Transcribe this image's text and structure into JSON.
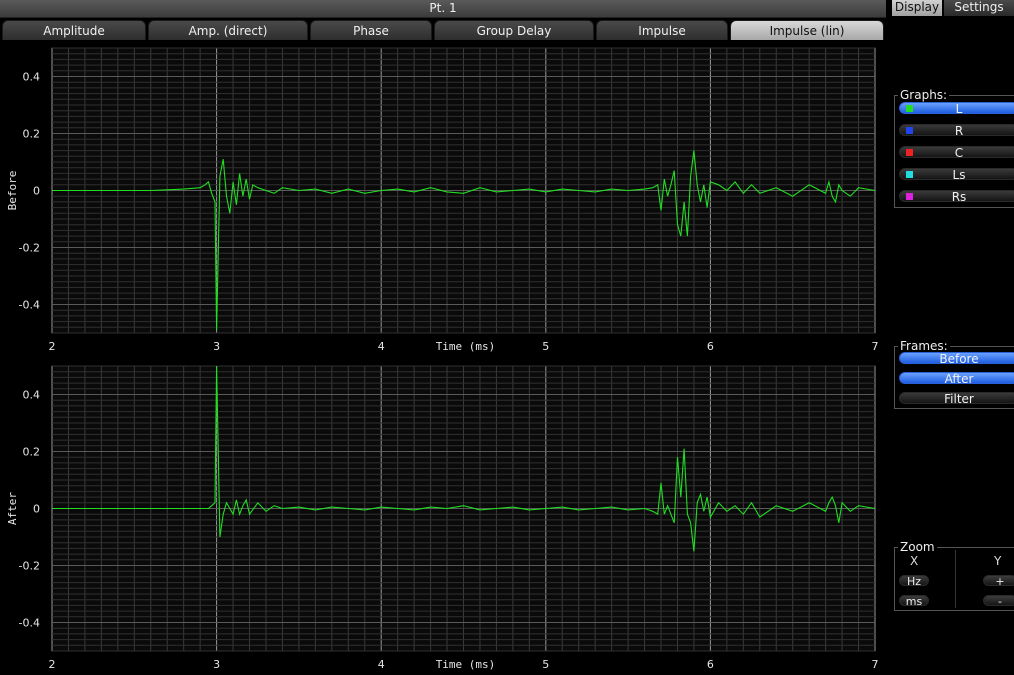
{
  "window": {
    "title": "Pt. 1"
  },
  "tabs": [
    {
      "label": "Amplitude"
    },
    {
      "label": "Amp. (direct)"
    },
    {
      "label": "Phase"
    },
    {
      "label": "Group Delay"
    },
    {
      "label": "Impulse"
    },
    {
      "label": "Impulse (lin)",
      "active": true
    }
  ],
  "side_tabs": {
    "display": "Display",
    "settings": "Settings"
  },
  "graphs": {
    "title": "Graphs:",
    "items": [
      {
        "label": "L",
        "color": "#22dd22",
        "on": true
      },
      {
        "label": "R",
        "color": "#2244ee",
        "on": false
      },
      {
        "label": "C",
        "color": "#ee2222",
        "on": false
      },
      {
        "label": "Ls",
        "color": "#22dddd",
        "on": false
      },
      {
        "label": "Rs",
        "color": "#dd22dd",
        "on": false
      }
    ]
  },
  "frames": {
    "title": "Frames:",
    "items": [
      {
        "label": "Before",
        "on": true
      },
      {
        "label": "After",
        "on": true
      },
      {
        "label": "Filter",
        "on": false
      }
    ]
  },
  "zoom": {
    "title": "Zoom",
    "x_label": "X",
    "y_label": "Y",
    "hz": "Hz",
    "ms": "ms",
    "plus": "+",
    "minus": "-"
  },
  "chart_data": [
    {
      "type": "line",
      "ylabel": "Before",
      "xlabel": "Time (ms)",
      "xlim": [
        2,
        7
      ],
      "ylim": [
        -0.5,
        0.5
      ],
      "x_ticks": [
        2,
        3,
        4,
        5,
        6,
        7
      ],
      "y_ticks": [
        0.4,
        0.2,
        0,
        -0.2,
        -0.4
      ],
      "y_tick_labels": [
        "0.4",
        "0.2",
        "0",
        "-0.2",
        "-0.4"
      ],
      "grid": true,
      "series": [
        {
          "color": "#22dd22",
          "x": [
            2.0,
            2.6,
            2.8,
            2.9,
            2.93,
            2.95,
            2.97,
            2.99,
            3.0,
            3.02,
            3.04,
            3.06,
            3.08,
            3.1,
            3.12,
            3.14,
            3.16,
            3.18,
            3.2,
            3.22,
            3.25,
            3.3,
            3.35,
            3.4,
            3.5,
            3.6,
            3.7,
            3.8,
            3.9,
            4.0,
            4.1,
            4.2,
            4.3,
            4.4,
            4.5,
            4.6,
            4.7,
            4.8,
            4.9,
            5.0,
            5.1,
            5.2,
            5.3,
            5.4,
            5.5,
            5.6,
            5.65,
            5.68,
            5.7,
            5.72,
            5.74,
            5.76,
            5.78,
            5.8,
            5.82,
            5.84,
            5.86,
            5.88,
            5.9,
            5.92,
            5.94,
            5.96,
            5.98,
            6.0,
            6.05,
            6.1,
            6.15,
            6.2,
            6.25,
            6.3,
            6.4,
            6.5,
            6.6,
            6.7,
            6.72,
            6.74,
            6.76,
            6.78,
            6.8,
            6.85,
            6.9,
            7.0
          ],
          "y": [
            0,
            0,
            0.005,
            0.01,
            0.02,
            0.03,
            -0.01,
            -0.04,
            -0.49,
            0.05,
            0.11,
            -0.02,
            -0.08,
            0.03,
            -0.05,
            0.06,
            -0.02,
            0.04,
            -0.03,
            0.02,
            0.01,
            0.0,
            -0.01,
            0.01,
            0.0,
            0.005,
            -0.01,
            0.005,
            -0.01,
            0.0,
            0.005,
            -0.005,
            0.01,
            -0.005,
            -0.01,
            0.01,
            -0.005,
            0.0,
            0.005,
            -0.005,
            0.005,
            0.0,
            -0.005,
            0.005,
            0.0,
            0.005,
            0.01,
            0.02,
            -0.07,
            0.04,
            -0.02,
            0.02,
            0.07,
            -0.12,
            -0.16,
            -0.04,
            -0.16,
            0.05,
            0.14,
            0.02,
            -0.04,
            0.02,
            -0.06,
            0.03,
            0.02,
            0.0,
            0.03,
            -0.01,
            0.02,
            -0.01,
            0.01,
            -0.02,
            0.02,
            -0.01,
            0.03,
            -0.02,
            -0.04,
            0.02,
            0.0,
            -0.02,
            0.01,
            0.0
          ]
        }
      ]
    },
    {
      "type": "line",
      "ylabel": "After",
      "xlabel": "Time (ms)",
      "xlim": [
        2,
        7
      ],
      "ylim": [
        -0.5,
        0.5
      ],
      "x_ticks": [
        2,
        3,
        4,
        5,
        6,
        7
      ],
      "y_ticks": [
        0.4,
        0.2,
        0,
        -0.2,
        -0.4
      ],
      "y_tick_labels": [
        "0.4",
        "0.2",
        "0",
        "-0.2",
        "-0.4"
      ],
      "grid": true,
      "series": [
        {
          "color": "#22dd22",
          "x": [
            2.0,
            2.6,
            2.8,
            2.9,
            2.95,
            2.97,
            2.99,
            3.0,
            3.02,
            3.04,
            3.06,
            3.08,
            3.1,
            3.12,
            3.14,
            3.16,
            3.18,
            3.2,
            3.25,
            3.3,
            3.35,
            3.4,
            3.5,
            3.6,
            3.7,
            3.8,
            3.9,
            4.0,
            4.1,
            4.2,
            4.3,
            4.4,
            4.5,
            4.6,
            4.7,
            4.8,
            4.9,
            5.0,
            5.1,
            5.2,
            5.3,
            5.4,
            5.5,
            5.6,
            5.65,
            5.68,
            5.7,
            5.72,
            5.74,
            5.76,
            5.78,
            5.8,
            5.82,
            5.84,
            5.86,
            5.88,
            5.9,
            5.92,
            5.94,
            5.96,
            5.98,
            6.0,
            6.05,
            6.1,
            6.15,
            6.2,
            6.25,
            6.3,
            6.4,
            6.5,
            6.6,
            6.7,
            6.72,
            6.74,
            6.76,
            6.78,
            6.8,
            6.85,
            6.9,
            7.0
          ],
          "y": [
            0,
            0,
            0.0,
            0.0,
            0.0,
            0.01,
            0.02,
            0.5,
            -0.1,
            -0.02,
            0.02,
            0.0,
            -0.02,
            0.03,
            -0.02,
            0.01,
            0.03,
            -0.02,
            0.02,
            -0.01,
            0.01,
            0.0,
            0.005,
            -0.005,
            0.005,
            0.0,
            -0.005,
            0.005,
            0.0,
            -0.005,
            0.005,
            0.0,
            0.01,
            -0.005,
            0.0,
            0.005,
            -0.005,
            0.0,
            0.005,
            -0.005,
            0.0,
            0.005,
            -0.005,
            0.0,
            -0.01,
            -0.02,
            0.09,
            -0.02,
            0.01,
            -0.02,
            -0.05,
            0.18,
            0.04,
            0.21,
            -0.02,
            -0.05,
            -0.15,
            0.02,
            0.05,
            -0.01,
            0.04,
            -0.03,
            0.02,
            -0.01,
            0.01,
            -0.02,
            0.02,
            -0.03,
            0.01,
            -0.01,
            0.02,
            -0.01,
            0.02,
            0.04,
            0.01,
            -0.05,
            0.02,
            -0.01,
            0.01,
            0.0
          ]
        }
      ]
    }
  ]
}
